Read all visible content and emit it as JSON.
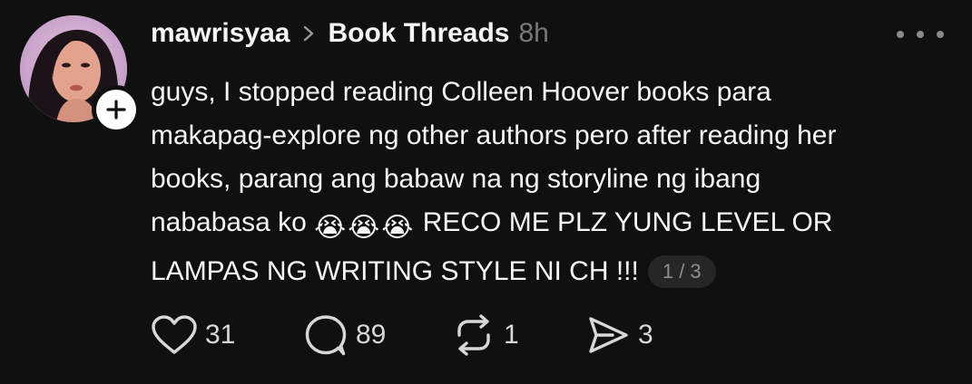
{
  "post": {
    "username": "mawrisyaa",
    "topic": "Book Threads",
    "time": "8h",
    "text_lines": [
      "guys, I stopped reading Colleen Hoover books para",
      "makapag-explore ng other authors pero after reading her",
      "books, parang ang babaw na ng storyline ng ibang",
      "nababasa ko",
      "RECO ME PLZ YUNG LEVEL OR",
      "LAMPAS NG WRITING STYLE NI CH !!!"
    ],
    "emoji": [
      "😭",
      "😭",
      "😭"
    ],
    "pager": "1 / 3"
  },
  "actions": {
    "likes": "31",
    "replies": "89",
    "reposts": "1",
    "shares": "3"
  },
  "icons": {
    "chevron": "chevron-right-icon",
    "like": "heart-icon",
    "reply": "comment-bubble-icon",
    "repost": "repost-icon",
    "share": "send-icon",
    "follow": "plus-icon",
    "more": "more-dots-icon"
  },
  "colors": {
    "background": "#101010",
    "text": "#f3f5f7",
    "muted": "#777777",
    "pager_bg": "#262626"
  }
}
